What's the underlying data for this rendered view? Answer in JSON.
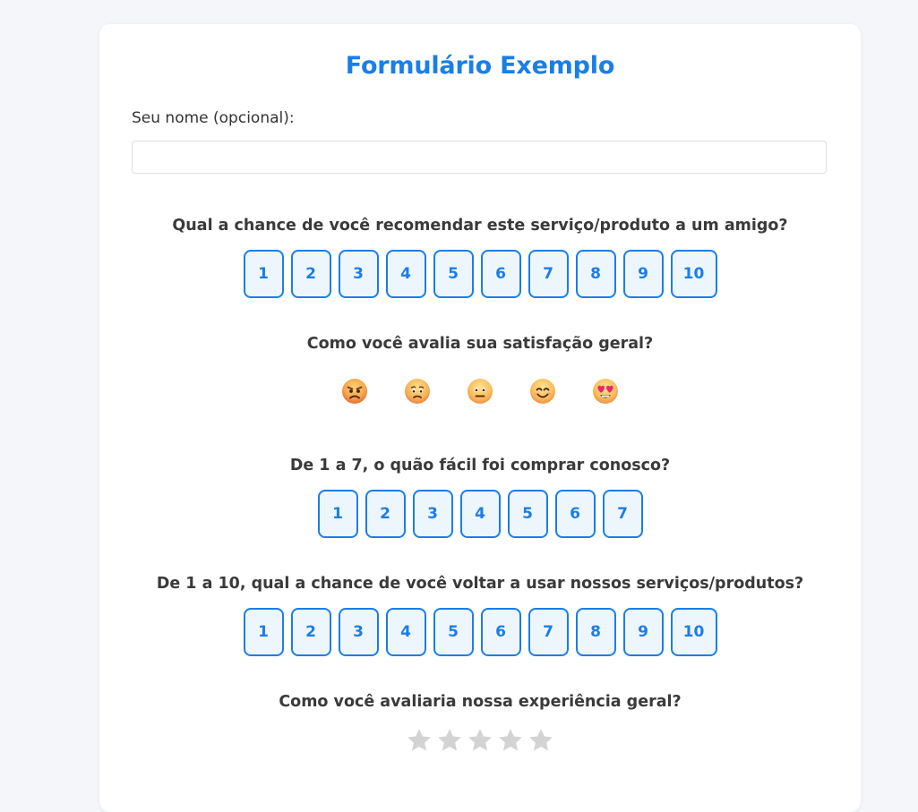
{
  "form": {
    "title": "Formulário Exemplo",
    "name_label": "Seu nome (opcional):",
    "name_value": "",
    "name_placeholder": ""
  },
  "questions": [
    {
      "text": "Qual a chance de você recomendar este serviço/produto a um amigo?",
      "type": "scale",
      "options": [
        "1",
        "2",
        "3",
        "4",
        "5",
        "6",
        "7",
        "8",
        "9",
        "10"
      ]
    },
    {
      "text": "Como você avalia sua satisfação geral?",
      "type": "emoji",
      "options": [
        "angry-face-icon",
        "sad-face-icon",
        "neutral-face-icon",
        "smiling-face-icon",
        "heart-eyes-face-icon"
      ]
    },
    {
      "text": "De 1 a 7, o quão fácil foi comprar conosco?",
      "type": "scale",
      "options": [
        "1",
        "2",
        "3",
        "4",
        "5",
        "6",
        "7"
      ]
    },
    {
      "text": "De 1 a 10, qual a chance de você voltar a usar nossos serviços/produtos?",
      "type": "scale",
      "options": [
        "1",
        "2",
        "3",
        "4",
        "5",
        "6",
        "7",
        "8",
        "9",
        "10"
      ]
    },
    {
      "text": "Como você avaliaria nossa experiência geral?",
      "type": "stars",
      "max_stars": 5,
      "selected_stars": 0
    }
  ],
  "colors": {
    "accent": "#1a7ee8",
    "button_bg": "#eef6fd",
    "star_empty": "#d3d3d3",
    "page_bg": "#f4f6f9"
  }
}
